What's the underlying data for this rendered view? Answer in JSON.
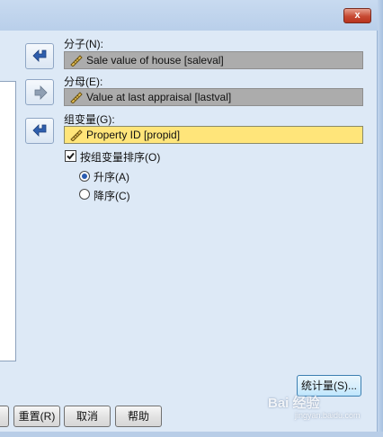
{
  "titlebar": {
    "close_glyph": "x"
  },
  "numerator": {
    "label": "分子(N):",
    "value": "Sale value of house [saleval]",
    "icon": "ruler-icon"
  },
  "denominator": {
    "label": "分母(E):",
    "value": "Value at last appraisal [lastval]",
    "icon": "ruler-icon"
  },
  "group": {
    "label": "组变量(G):",
    "value": "Property ID [propid]",
    "icon": "ruler-icon"
  },
  "sort_by_group": {
    "label": "按组变量排序(O)",
    "checked": true
  },
  "sort_order": {
    "options": [
      {
        "label": "升序(A)",
        "selected": true
      },
      {
        "label": "降序(C)",
        "selected": false
      }
    ]
  },
  "buttons": {
    "statistics": "统计量(S)...",
    "reset": "重置(R)",
    "cancel": "取消",
    "help": "帮助"
  },
  "watermark": {
    "main": "Bai 经验",
    "sub": "jingyan.baidu.com"
  },
  "colors": {
    "dialog_bg": "#dde9f6",
    "active_field": "#ffe57a",
    "inactive_field": "#acacac",
    "arrow_blue": "#2f5fae"
  }
}
